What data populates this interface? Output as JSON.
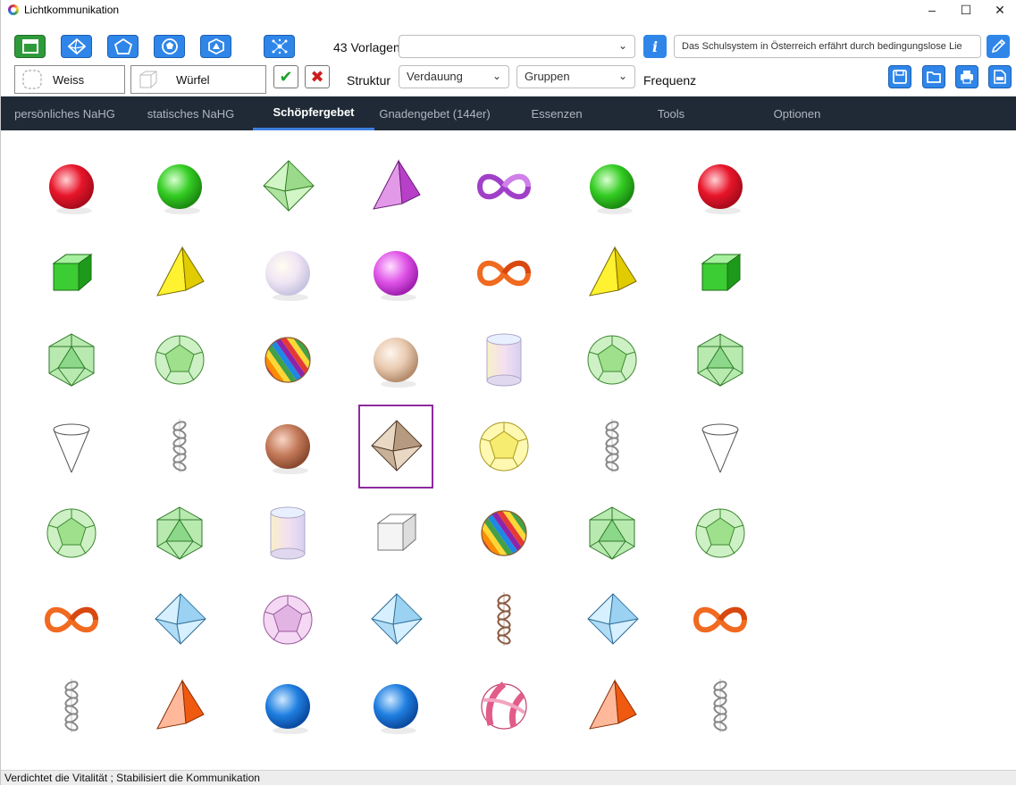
{
  "window": {
    "title": "Lichtkommunikation"
  },
  "toolbar": {
    "view_buttons": [
      {
        "icon": "square-frame-icon",
        "color": "green"
      },
      {
        "icon": "octahedron-icon",
        "color": "blue"
      },
      {
        "icon": "pentagon-icon",
        "color": "blue"
      },
      {
        "icon": "dodecahedron-icon",
        "color": "blue"
      },
      {
        "icon": "icosahedron-icon",
        "color": "blue"
      },
      {
        "icon": "network-icon",
        "color": "blue"
      }
    ],
    "template_count": "43 Vorlagen",
    "template_select_value": "",
    "text_field_value": "Das Schulsystem in Österreich erfährt durch bedingungslose Lie",
    "color_name": "Weiss",
    "shape_name": "Würfel",
    "struktur_label": "Struktur",
    "struktur_value": "Verdauung",
    "gruppen_value": "Gruppen",
    "frequenz_label": "Frequenz"
  },
  "nav": {
    "tabs": [
      {
        "label": "persönliches NaHG",
        "active": false
      },
      {
        "label": "statisches NaHG",
        "active": false
      },
      {
        "label": "Schöpfergebet",
        "active": true
      },
      {
        "label": "Gnadengebet (144er)",
        "active": false
      },
      {
        "label": "Essenzen",
        "active": false
      },
      {
        "label": "Tools",
        "active": false
      },
      {
        "label": "Optionen",
        "active": false
      }
    ]
  },
  "grid": {
    "selected_index": 24,
    "items": [
      "red-sphere",
      "green-sphere",
      "green-octahedron",
      "magenta-pyramid",
      "purple-infinity",
      "green-sphere",
      "red-sphere",
      "green-cube",
      "yellow-pyramid",
      "pastel-sphere",
      "pink-sphere",
      "orange-infinity",
      "yellow-pyramid",
      "green-cube",
      "green-icosahedron",
      "green-dodecahedron",
      "rainbow-sphere",
      "beige-sphere",
      "pastel-cylinder",
      "green-dodecahedron",
      "green-icosahedron",
      "white-cone",
      "grey-dna",
      "brown-sphere",
      "brown-octahedron",
      "yellow-dodecahedron",
      "grey-dna",
      "white-cone",
      "green-dodecahedron",
      "green-icosahedron",
      "pastel-cylinder",
      "white-cube",
      "rainbow-sphere",
      "green-icosahedron",
      "green-dodecahedron",
      "orange-infinity",
      "blue-octahedron",
      "pink-dodecahedron",
      "blue-octahedron",
      "brown-dna",
      "blue-octahedron",
      "orange-infinity",
      "grey-dna",
      "orange-pyramid",
      "blue-sphere",
      "blue-sphere",
      "pink-beachball",
      "orange-pyramid",
      "grey-dna"
    ]
  },
  "status": {
    "text": "Verdichtet die Vitalität ; Stabilisiert die Kommunikation"
  }
}
